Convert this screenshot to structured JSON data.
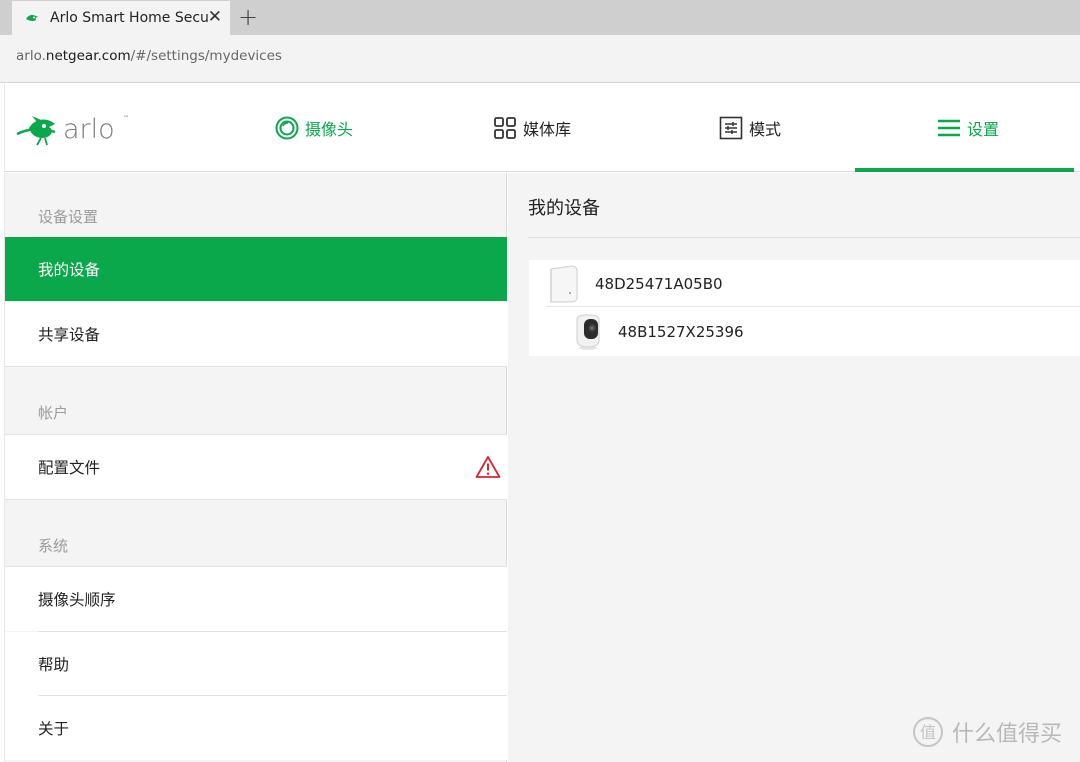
{
  "browser": {
    "tab_title": "Arlo Smart Home Secur",
    "url_prefix": "arlo.",
    "url_domain": "netgear.com",
    "url_path": "/#/settings/mydevices"
  },
  "nav": {
    "cameras": "摄像头",
    "library": "媒体库",
    "modes": "模式",
    "settings": "设置"
  },
  "sidebar": {
    "section_device": "设备设置",
    "my_devices": "我的设备",
    "shared_devices": "共享设备",
    "section_account": "帐户",
    "profile": "配置文件",
    "section_system": "系统",
    "camera_order": "摄像头顺序",
    "help": "帮助",
    "about": "关于"
  },
  "main": {
    "title": "我的设备",
    "devices": [
      {
        "name": "48D25471A05B0",
        "icon": "base-station-icon"
      },
      {
        "name": "48B1527X25396",
        "icon": "camera-device-icon"
      }
    ]
  },
  "watermark": "什么值得买",
  "colors": {
    "accent": "#0ba74b",
    "warning": "#d9232e"
  }
}
